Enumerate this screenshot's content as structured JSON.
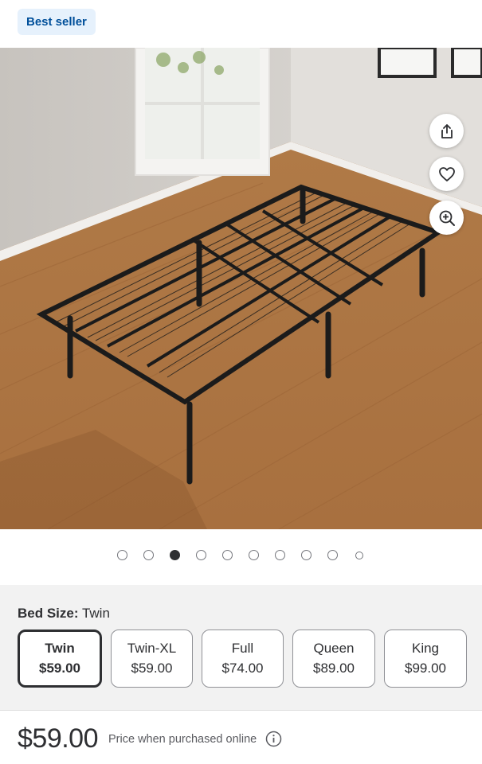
{
  "badge": {
    "label": "Best seller"
  },
  "gallery": {
    "image_alt": "Black folding metal platform bed frame on a wood floor",
    "actions": {
      "share_icon": "share-icon",
      "favorite_icon": "heart-icon",
      "zoom_icon": "zoom-in-icon"
    },
    "image_count": 10,
    "active_index": 2
  },
  "variant": {
    "label": "Bed Size:",
    "selected_value": "Twin",
    "options": [
      {
        "name": "Twin",
        "price": "$59.00",
        "selected": true
      },
      {
        "name": "Twin-XL",
        "price": "$59.00",
        "selected": false
      },
      {
        "name": "Full",
        "price": "$74.00",
        "selected": false
      },
      {
        "name": "Queen",
        "price": "$89.00",
        "selected": false
      },
      {
        "name": "King",
        "price": "$99.00",
        "selected": false
      }
    ]
  },
  "price": {
    "amount": "$59.00",
    "note": "Price when purchased online",
    "info_icon": "info-icon"
  },
  "colors": {
    "badge_bg": "#e6f1fc",
    "badge_text": "#004f9a",
    "panel_bg": "#f2f2f2",
    "text": "#2e2f32"
  }
}
